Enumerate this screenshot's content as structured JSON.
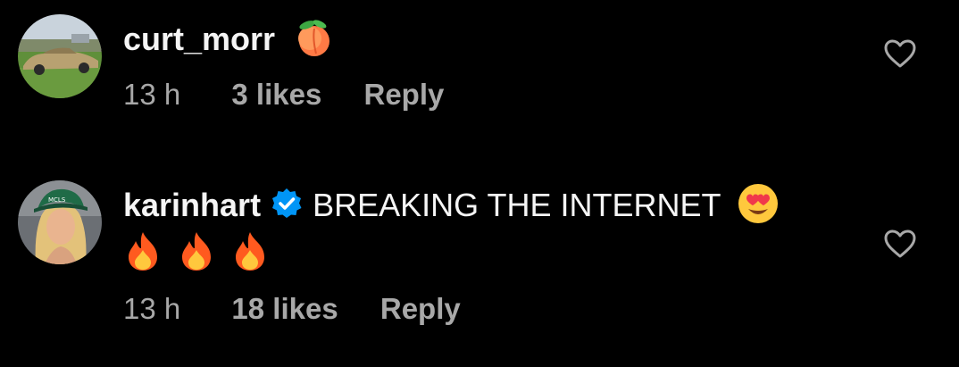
{
  "comments": [
    {
      "username": "curt_morr",
      "text": "",
      "emojis": [
        "peach"
      ],
      "verified": false,
      "time": "13 h",
      "likes": "3 likes",
      "reply": "Reply",
      "avatar_icon": "vintage-car-photo"
    },
    {
      "username": "karinhart",
      "text": "BREAKING THE INTERNET",
      "emojis": [
        "heart-eyes",
        "fire",
        "fire",
        "fire"
      ],
      "verified": true,
      "time": "13 h",
      "likes": "18 likes",
      "reply": "Reply",
      "avatar_icon": "profile-photo-woman-cap"
    }
  ],
  "colors": {
    "background": "#000000",
    "text": "#f5f5f5",
    "meta": "#a8a8a8",
    "verified": "#0095f6"
  },
  "icons": {
    "like": "heart-outline-icon",
    "verified": "verified-badge-icon"
  }
}
